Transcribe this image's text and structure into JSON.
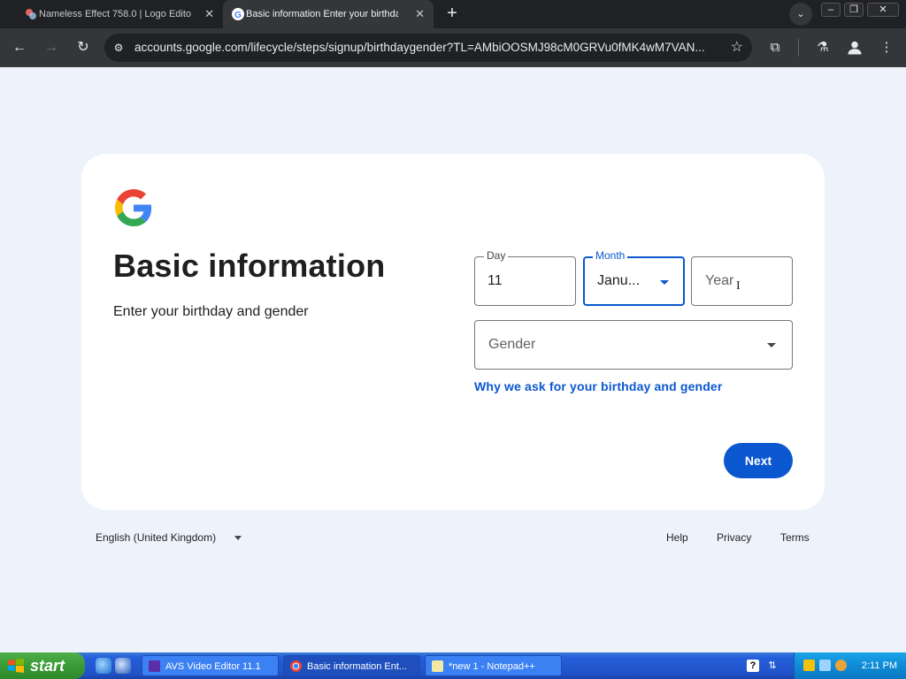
{
  "browser": {
    "tabs": [
      {
        "label": "Nameless Effect 758.0 | Logo Edito",
        "active": false
      },
      {
        "label": "Basic information Enter your birthday",
        "active": true
      }
    ],
    "new_tab_icon": "plus-icon",
    "tab_search_icon": "chevron-down-icon",
    "window_controls": {
      "minimize": "–",
      "maximize": "❐",
      "close": "✕"
    },
    "url": "accounts.google.com/lifecycle/steps/signup/birthdaygender?TL=AMbiOOSMJ98cM0GRVu0fMK4wM7VAN...",
    "nav": {
      "back": "←",
      "forward": "→",
      "reload": "↻"
    }
  },
  "page": {
    "title": "Basic information",
    "subtitle": "Enter your birthday and gender",
    "day": {
      "label": "Day",
      "value": "11"
    },
    "month": {
      "label": "Month",
      "value": "Janu..."
    },
    "year": {
      "placeholder": "Year"
    },
    "gender": {
      "placeholder": "Gender"
    },
    "why_link": "Why we ask for your birthday and gender",
    "next_label": "Next",
    "accent_color": "#0b57d0"
  },
  "footer": {
    "language": "English (United Kingdom)",
    "links": {
      "help": "Help",
      "privacy": "Privacy",
      "terms": "Terms"
    }
  },
  "taskbar": {
    "start_label": "start",
    "tasks": [
      {
        "label": "AVS Video Editor 11.1"
      },
      {
        "label": "Basic information Ent..."
      },
      {
        "label": "*new 1 - Notepad++"
      }
    ],
    "clock": "2:11 PM"
  }
}
